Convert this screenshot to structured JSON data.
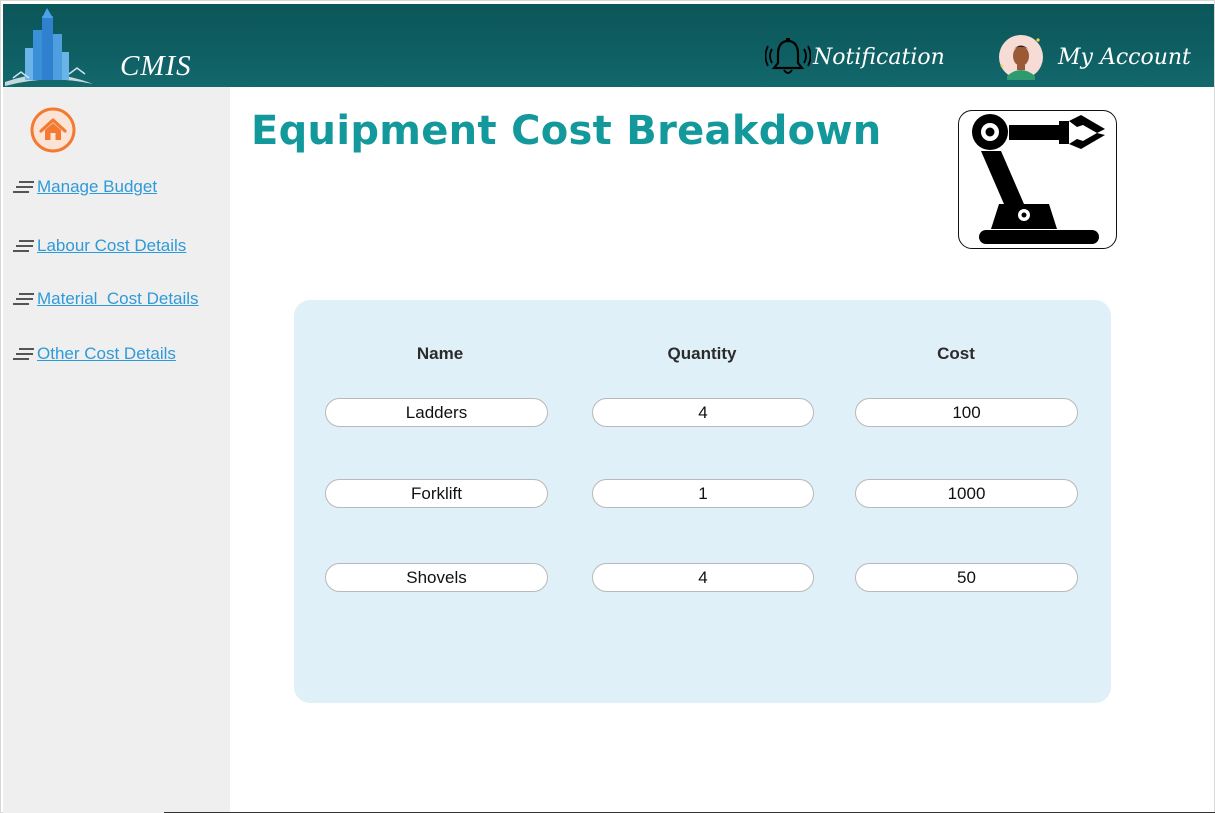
{
  "header": {
    "brand": "CMIS",
    "notification_label": "Notification",
    "account_label": "My Account"
  },
  "sidebar": {
    "items": [
      {
        "label": "Manage Budget"
      },
      {
        "label": "Labour Cost Details"
      },
      {
        "label": "Material  Cost Details"
      },
      {
        "label": "Other Cost Details"
      }
    ]
  },
  "main": {
    "title": "Equipment Cost Breakdown",
    "table": {
      "headers": [
        "Name",
        "Quantity",
        "Cost"
      ],
      "rows": [
        {
          "name": "Ladders",
          "quantity": "4",
          "cost": "100"
        },
        {
          "name": "Forklift",
          "quantity": "1",
          "cost": "1000"
        },
        {
          "name": "Shovels",
          "quantity": "4",
          "cost": "50"
        }
      ]
    }
  },
  "colors": {
    "header_bg": "#0e5f63",
    "title": "#13999b",
    "link": "#2f9ad8",
    "home_accent": "#f47a32",
    "panel_bg": "#e0f0f9",
    "sidebar_bg": "#efefef"
  },
  "icons": [
    "building-logo-icon",
    "bell-icon",
    "user-avatar-icon",
    "home-icon",
    "menu-icon",
    "robot-arm-icon"
  ]
}
